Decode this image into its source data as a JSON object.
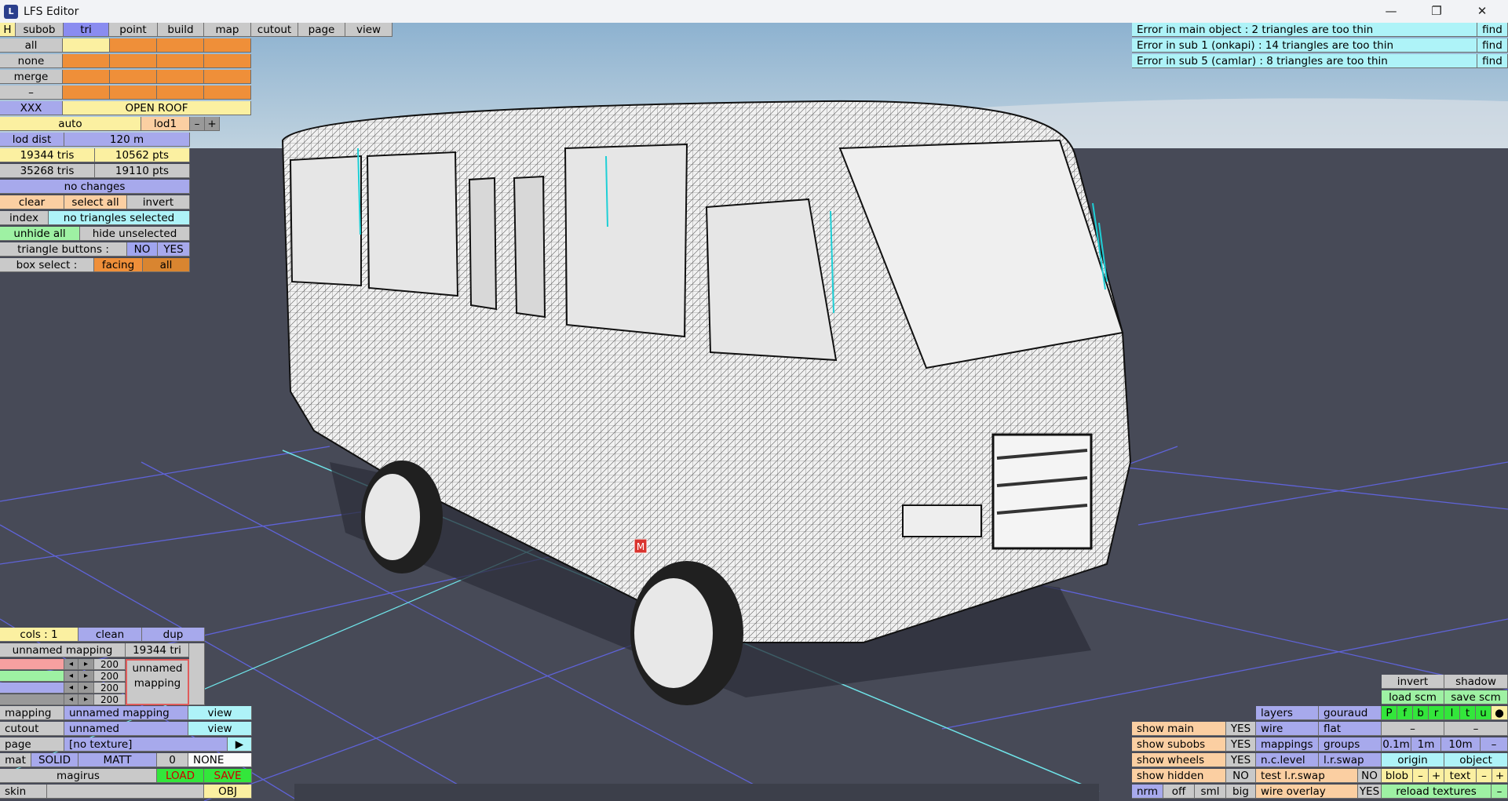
{
  "window": {
    "title": "LFS Editor",
    "icon": "L",
    "minimize": "—",
    "maximize": "❐",
    "close": "✕"
  },
  "tabs": [
    "H",
    "subob",
    "tri",
    "point",
    "build",
    "map",
    "cutout",
    "page",
    "view"
  ],
  "sel": {
    "all": "all",
    "none": "none",
    "merge": "merge",
    "dash": "–",
    "xxx": "XXX",
    "open_roof": "OPEN ROOF"
  },
  "lod": {
    "auto": "auto",
    "lod1": "lod1",
    "minus": "–",
    "plus": "+",
    "dist_label": "lod dist",
    "dist_value": "120 m",
    "tris1": "19344 tris",
    "pts1": "10562 pts",
    "tris2": "35268 tris",
    "pts2": "19110 pts"
  },
  "status": "no changes",
  "actions": {
    "clear": "clear",
    "select_all": "select all",
    "invert": "invert",
    "index": "index",
    "selection": "no triangles selected",
    "unhide_all": "unhide all",
    "hide_unselected": "hide unselected",
    "tri_buttons": "triangle buttons :",
    "no": "NO",
    "yes": "YES",
    "box_select": "box select :",
    "facing": "facing",
    "all": "all"
  },
  "errors": [
    {
      "text": "Error in main object : 2 triangles are too thin",
      "find": "find"
    },
    {
      "text": "Error in sub 1 (onkapi) : 14 triangles are too thin",
      "find": "find"
    },
    {
      "text": "Error in sub 5 (camlar) : 8 triangles are too thin",
      "find": "find"
    }
  ],
  "mapping_panel": {
    "cols": "cols : 1",
    "clean": "clean",
    "dup": "dup",
    "name": "unnamed mapping",
    "tri": "19344 tri",
    "v1": "200",
    "v2": "200",
    "v3": "200",
    "preview": [
      "unnamed",
      "mapping"
    ],
    "left": "◂",
    "right": "▸"
  },
  "props": {
    "mapping_label": "mapping",
    "mapping_value": "unnamed mapping",
    "view": "view",
    "cutout_label": "cutout",
    "cutout_value": "unnamed",
    "page_label": "page",
    "page_value": "[no texture]",
    "arrow": "▶",
    "mat": "mat",
    "solid": "SOLID",
    "matt": "MATT",
    "zero": "0",
    "none": "NONE",
    "object_name": "magirus",
    "load": "LOAD",
    "save": "SAVE",
    "skin": "skin",
    "obj": "OBJ"
  },
  "view_panel": {
    "invert": "invert",
    "shadow": "shadow",
    "load_scm": "load scm",
    "save_scm": "save scm",
    "layers": "layers",
    "gouraud": "gouraud",
    "flags": [
      "P",
      "f",
      "b",
      "r",
      "l",
      "t",
      "u",
      "●"
    ],
    "show_main": "show main",
    "yes": "YES",
    "wire": "wire",
    "flat": "flat",
    "dash": "–",
    "show_subobs": "show subobs",
    "mappings": "mappings",
    "groups": "groups",
    "d1": "0.1m",
    "d2": "1m",
    "d3": "10m",
    "show_wheels": "show wheels",
    "nclevel": "n.c.level",
    "lrswap": "l.r.swap",
    "origin": "origin",
    "object": "object",
    "show_hidden": "show hidden",
    "no": "NO",
    "test_lrswap": "test l.r.swap",
    "blob": "blob",
    "minus": "–",
    "plus": "+",
    "text": "text",
    "nrm": "nrm",
    "off": "off",
    "sml": "sml",
    "big": "big",
    "wire_overlay": "wire overlay",
    "reload": "reload textures",
    "m": "M"
  }
}
